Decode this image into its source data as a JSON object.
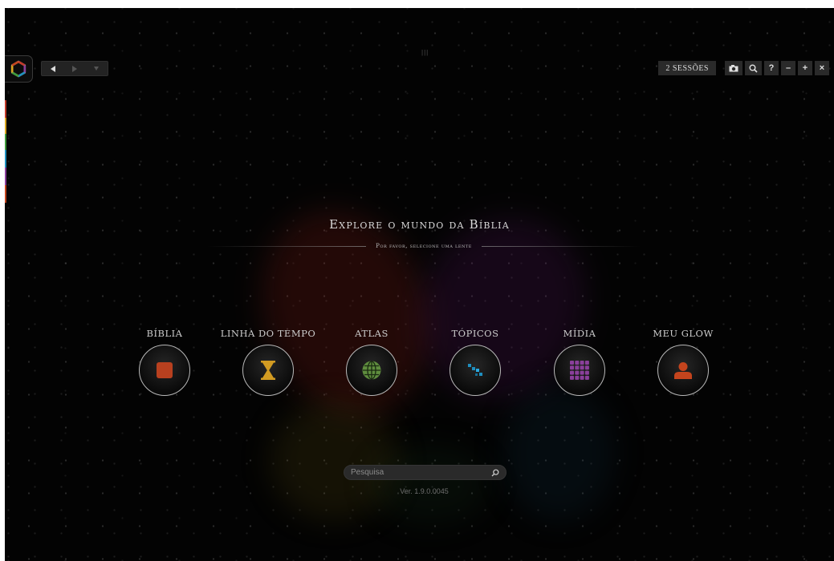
{
  "toolbar": {
    "sessions_label": "2 SESSÕES",
    "help_label": "?",
    "minimize_label": "–",
    "maximize_label": "+",
    "close_label": "×"
  },
  "icons": {
    "logo": "glow-logo-icon",
    "back": "back-arrow-icon",
    "forward": "forward-arrow-icon",
    "history": "history-dropdown-icon",
    "screenshot": "camera-icon",
    "zoom": "magnifier-icon",
    "search": "search-icon"
  },
  "header": {
    "title": "Explore o mundo da Bíblia",
    "subtitle": "Por favor, selecione uma lente"
  },
  "lenses": [
    {
      "label": "BÍBLIA",
      "icon": "bible-icon",
      "color": "#b8401f"
    },
    {
      "label": "LINHA DO TEMPO",
      "icon": "hourglass-icon",
      "color": "#d29b22"
    },
    {
      "label": "ATLAS",
      "icon": "globe-icon",
      "color": "#5f8d3e"
    },
    {
      "label": "TÓPICOS",
      "icon": "topics-icon",
      "color": "#1f8fbf"
    },
    {
      "label": "MÍDIA",
      "icon": "media-grid-icon",
      "color": "#8a3f9b"
    },
    {
      "label": "MEU GLOW",
      "icon": "user-icon",
      "color": "#c4441d"
    }
  ],
  "search": {
    "placeholder": "Pesquisa"
  },
  "version": "Ver. 1.9.0.0045",
  "side_colors": [
    "#c23a2a",
    "#d9a520",
    "#3f9a3a",
    "#1f8fbf",
    "#8a3f9b",
    "#c4441d"
  ]
}
